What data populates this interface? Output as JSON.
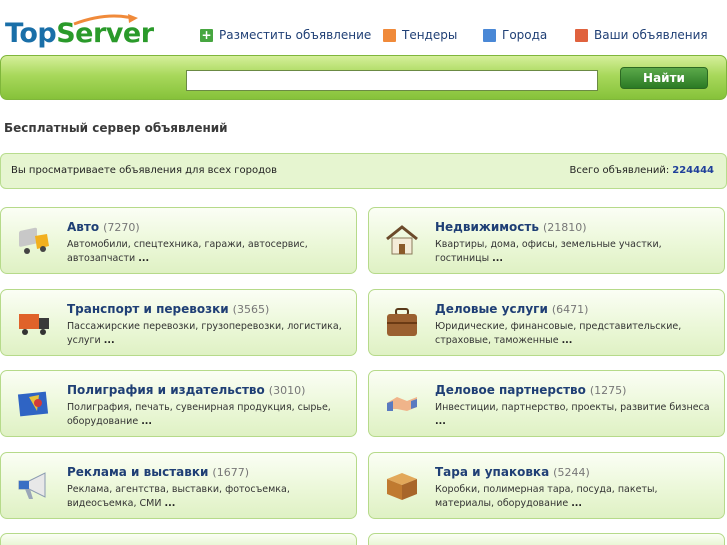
{
  "logo": {
    "part1": "Top",
    "part2": "Server"
  },
  "nav": [
    {
      "label": "Разместить объявление",
      "icon": "plus-icon",
      "color": "#47a640"
    },
    {
      "label": "Тендеры",
      "icon": "orange-square-icon",
      "color": "#f08a3a"
    },
    {
      "label": "Города",
      "icon": "blue-square-icon",
      "color": "#4a88d6"
    },
    {
      "label": "Ваши объявления",
      "icon": "red-square-icon",
      "color": "#e0623e"
    }
  ],
  "search": {
    "value": "",
    "button_label": "Найти"
  },
  "tagline": "Бесплатный сервер объявлений",
  "info": {
    "left": "Вы просматриваете объявления для всех городов",
    "total_label": "Всего объявлений:",
    "total_value": "224444"
  },
  "more_label": "...",
  "categories": [
    {
      "title": "Авто",
      "count": "(7270)",
      "desc": "Автомобили, спецтехника, гаражи, автосервис, автозапчасти",
      "icon": "truck-icon"
    },
    {
      "title": "Недвижимость",
      "count": "(21810)",
      "desc": "Квартиры, дома, офисы, земельные участки, гостиницы",
      "icon": "house-icon"
    },
    {
      "title": "Транспорт и перевозки",
      "count": "(3565)",
      "desc": "Пассажирские перевозки, грузоперевозки, логистика, услуги",
      "icon": "lorry-icon"
    },
    {
      "title": "Деловые услуги",
      "count": "(6471)",
      "desc": "Юридические, финансовые, представительские, страховые, таможенные",
      "icon": "briefcase-icon"
    },
    {
      "title": "Полиграфия и издательство",
      "count": "(3010)",
      "desc": "Полиграфия, печать, сувенирная продукция, сырье, оборудование",
      "icon": "print-icon"
    },
    {
      "title": "Деловое партнерство",
      "count": "(1275)",
      "desc": "Инвестиции, партнерство, проекты, развитие бизнеса",
      "icon": "handshake-icon"
    },
    {
      "title": "Реклама и выставки",
      "count": "(1677)",
      "desc": "Реклама, агентства, выставки, фотосъемка, видеосъемка, СМИ",
      "icon": "megaphone-icon"
    },
    {
      "title": "Тара и упаковка",
      "count": "(5244)",
      "desc": "Коробки, полимерная тара, посуда, пакеты, материалы, оборудование",
      "icon": "box-icon"
    }
  ]
}
